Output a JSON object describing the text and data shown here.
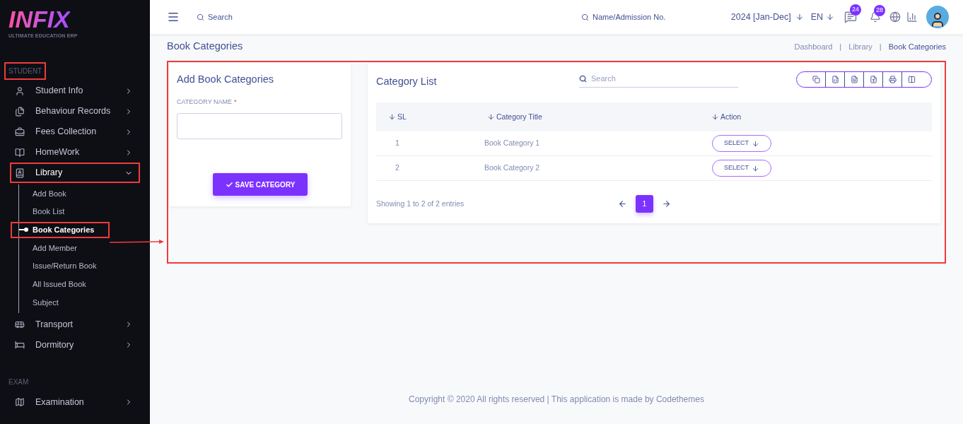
{
  "brand": {
    "name": "INFIX",
    "tagline": "ULTIMATE EDUCATION ERP"
  },
  "sidebar": {
    "sections": [
      {
        "label": "STUDENT",
        "annotated": true,
        "items": [
          {
            "label": "Student Info",
            "expanded": false,
            "annotated": false
          },
          {
            "label": "Behaviour Records",
            "expanded": false,
            "annotated": false
          },
          {
            "label": "Fees Collection",
            "expanded": false,
            "annotated": false
          },
          {
            "label": "HomeWork",
            "expanded": false,
            "annotated": false
          },
          {
            "label": "Library",
            "expanded": true,
            "annotated": true,
            "children": [
              {
                "label": "Add Book",
                "selected": false,
                "annotated": false
              },
              {
                "label": "Book List",
                "selected": false,
                "annotated": false
              },
              {
                "label": "Book Categories",
                "selected": true,
                "annotated": true
              },
              {
                "label": "Add Member",
                "selected": false,
                "annotated": false
              },
              {
                "label": "Issue/Return Book",
                "selected": false,
                "annotated": false
              },
              {
                "label": "All Issued Book",
                "selected": false,
                "annotated": false
              },
              {
                "label": "Subject",
                "selected": false,
                "annotated": false
              }
            ]
          },
          {
            "label": "Transport",
            "expanded": false,
            "annotated": false
          },
          {
            "label": "Dormitory",
            "expanded": false,
            "annotated": false
          }
        ]
      },
      {
        "label": "EXAM",
        "annotated": false,
        "items": [
          {
            "label": "Examination",
            "expanded": false,
            "annotated": false
          }
        ]
      }
    ]
  },
  "header": {
    "search": {
      "placeholder": "Search"
    },
    "student_search": {
      "placeholder": "Name/Admission No."
    },
    "session": "2024 [Jan-Dec]",
    "language": "EN",
    "messages_badge": "24",
    "notifications_badge": "28"
  },
  "page": {
    "title": "Book Categories",
    "breadcrumb_separator": "|",
    "breadcrumbs": [
      {
        "label": "Dashboard",
        "selected": false
      },
      {
        "label": "Library",
        "selected": false
      },
      {
        "label": "Book Categories",
        "selected": true
      }
    ]
  },
  "content": {
    "annotated": true,
    "form": {
      "title": "Add Book Categories",
      "field_label": "CATEGORY NAME",
      "required_mark": "*",
      "button": "SAVE CATEGORY"
    },
    "list": {
      "title": "Category List",
      "search": {
        "placeholder": "Search"
      },
      "columns": [
        "SL",
        "Category Title",
        "Action"
      ],
      "rows": [
        {
          "sl": "1",
          "title": "Book Category 1",
          "action": "SELECT"
        },
        {
          "sl": "2",
          "title": "Book Category 2",
          "action": "SELECT"
        }
      ],
      "summary": "Showing 1 to 2 of 2 entries",
      "pages": [
        {
          "label": "1",
          "selected": true
        }
      ]
    }
  },
  "footer": "Copyright © 2020 All rights reserved | This application is made by Codethemes"
}
